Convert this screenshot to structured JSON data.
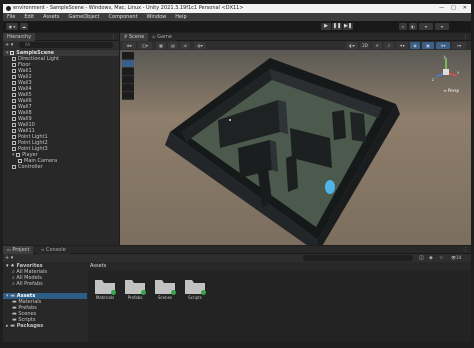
{
  "window": {
    "title": "environment - SampleScene - Windows, Mac, Linux - Unity 2021.3.19f1c1 Personal <DX11>",
    "controls": [
      "—",
      "□",
      "✕"
    ]
  },
  "menu": [
    "File",
    "Edit",
    "Assets",
    "GameObject",
    "Component",
    "Window",
    "Help"
  ],
  "toolbar": {
    "account_label": "◉ ▾",
    "cloud_icon": "cloud-icon",
    "play_buttons": [
      "▶",
      "❚❚",
      "▶❚"
    ]
  },
  "hierarchy": {
    "tab": "Hierarchy",
    "add_label": "+ ▾",
    "search_placeholder": "All",
    "scene": "SampleScene",
    "items": [
      {
        "label": "Directional Light",
        "depth": 1
      },
      {
        "label": "Floor",
        "depth": 1
      },
      {
        "label": "Wall1",
        "depth": 1
      },
      {
        "label": "Wall2",
        "depth": 1
      },
      {
        "label": "Wall3",
        "depth": 1
      },
      {
        "label": "Wall4",
        "depth": 1
      },
      {
        "label": "Wall5",
        "depth": 1
      },
      {
        "label": "Wall6",
        "depth": 1
      },
      {
        "label": "Wall7",
        "depth": 1
      },
      {
        "label": "Wall8",
        "depth": 1
      },
      {
        "label": "Wall9",
        "depth": 1
      },
      {
        "label": "Wall10",
        "depth": 1
      },
      {
        "label": "Wall11",
        "depth": 1
      },
      {
        "label": "Point Light1",
        "depth": 1
      },
      {
        "label": "Point Light2",
        "depth": 1
      },
      {
        "label": "Point Light3",
        "depth": 1
      },
      {
        "label": "Player",
        "depth": 1
      },
      {
        "label": "Main Camera",
        "depth": 2
      },
      {
        "label": "Controller",
        "depth": 1
      }
    ]
  },
  "scene_view": {
    "tabs": [
      "Scene",
      "Game"
    ],
    "persp_label": "≡ Persp",
    "gizmo_labels": {
      "y": "y",
      "x": "x",
      "z": "z"
    }
  },
  "bottom": {
    "tabs": [
      "Project",
      "Console"
    ],
    "add_label": "+ ▾",
    "count_badge": "14",
    "tree": [
      {
        "label": "Favorites",
        "bold": true,
        "depth": 0
      },
      {
        "label": "All Materials",
        "depth": 1
      },
      {
        "label": "All Models",
        "depth": 1
      },
      {
        "label": "All Prefabs",
        "depth": 1
      },
      {
        "label": "",
        "depth": 0
      },
      {
        "label": "Assets",
        "bold": true,
        "depth": 0,
        "selected": true
      },
      {
        "label": "Materials",
        "depth": 1
      },
      {
        "label": "Prefabs",
        "depth": 1
      },
      {
        "label": "Scenes",
        "depth": 1
      },
      {
        "label": "Scripts",
        "depth": 1
      },
      {
        "label": "Packages",
        "bold": true,
        "depth": 0
      }
    ],
    "assets_title": "Assets",
    "folders": [
      "Materials",
      "Prefabs",
      "Scenes",
      "Scripts"
    ]
  },
  "colors": {
    "selection": "#2c5d87",
    "folder": "#c2c2c2",
    "check": "#3aa34a",
    "sky": "#8c7b68"
  }
}
